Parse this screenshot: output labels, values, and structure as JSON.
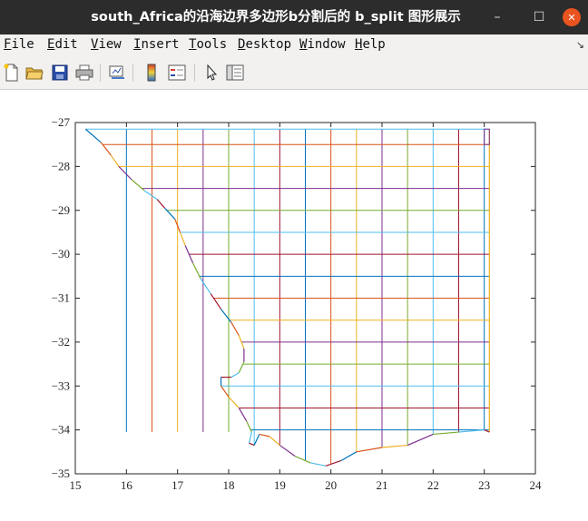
{
  "window": {
    "title": "south_Africa的沿海边界多边形b分割后的 b_split 图形展示",
    "minimize_glyph": "–",
    "maximize_glyph": "☐",
    "close_glyph": "✕"
  },
  "menu": {
    "items": [
      {
        "key": "F",
        "rest": "ile"
      },
      {
        "key": "E",
        "rest": "dit"
      },
      {
        "key": "V",
        "rest": "iew"
      },
      {
        "key": "I",
        "rest": "nsert"
      },
      {
        "key": "T",
        "rest": "ools"
      },
      {
        "key": "D",
        "rest": "esktop"
      },
      {
        "key": "W",
        "rest": "indow"
      },
      {
        "key": "H",
        "rest": "elp"
      }
    ],
    "overflow_glyph": "↘"
  },
  "toolbar": {
    "icons": [
      "new-figure-icon",
      "open-file-icon",
      "save-icon",
      "print-icon",
      "link-plot-icon",
      "colorbar-icon",
      "legend-icon",
      "pointer-icon",
      "property-editor-icon"
    ]
  },
  "chart_data": {
    "type": "line",
    "title": "",
    "xlabel": "",
    "ylabel": "",
    "xlim": [
      15,
      24
    ],
    "ylim": [
      -35,
      -27
    ],
    "xticks": [
      "15",
      "16",
      "17",
      "18",
      "19",
      "20",
      "21",
      "22",
      "23",
      "24"
    ],
    "yticks": [
      "-27",
      "-28",
      "-29",
      "-30",
      "-31",
      "-32",
      "-33",
      "-34",
      "-35"
    ],
    "grid_cell_deg": 0.5,
    "grid_east": 23.1,
    "grid_north": -27.15,
    "colors": [
      "#0072bd",
      "#d95319",
      "#edb120",
      "#7e2f8e",
      "#77ac30",
      "#4dbeee",
      "#a2142f"
    ],
    "boundary": {
      "west": [
        [
          15.2,
          -27.15
        ],
        [
          15.5,
          -27.45
        ],
        [
          15.7,
          -27.75
        ],
        [
          15.85,
          -28.0
        ],
        [
          16.1,
          -28.3
        ],
        [
          16.35,
          -28.55
        ],
        [
          16.6,
          -28.75
        ],
        [
          16.75,
          -28.95
        ],
        [
          16.95,
          -29.2
        ],
        [
          17.05,
          -29.5
        ],
        [
          17.15,
          -29.8
        ],
        [
          17.3,
          -30.2
        ],
        [
          17.45,
          -30.55
        ],
        [
          17.65,
          -30.9
        ],
        [
          17.85,
          -31.25
        ],
        [
          18.05,
          -31.55
        ],
        [
          18.2,
          -31.85
        ],
        [
          18.3,
          -32.15
        ],
        [
          18.3,
          -32.45
        ],
        [
          18.2,
          -32.7
        ],
        [
          18.05,
          -32.8
        ],
        [
          17.85,
          -32.8
        ],
        [
          17.85,
          -33.0
        ],
        [
          18.0,
          -33.25
        ],
        [
          18.2,
          -33.5
        ],
        [
          18.35,
          -33.8
        ],
        [
          18.45,
          -34.05
        ],
        [
          18.4,
          -34.3
        ],
        [
          18.5,
          -34.35
        ],
        [
          18.6,
          -34.1
        ],
        [
          18.8,
          -34.15
        ],
        [
          19.0,
          -34.35
        ],
        [
          19.3,
          -34.6
        ],
        [
          19.6,
          -34.75
        ],
        [
          19.9,
          -34.82
        ],
        [
          20.2,
          -34.7
        ],
        [
          20.5,
          -34.5
        ],
        [
          21.0,
          -34.4
        ],
        [
          21.5,
          -34.35
        ],
        [
          22.0,
          -34.1
        ],
        [
          22.5,
          -34.05
        ],
        [
          23.0,
          -34.0
        ],
        [
          23.1,
          -34.05
        ]
      ]
    }
  }
}
